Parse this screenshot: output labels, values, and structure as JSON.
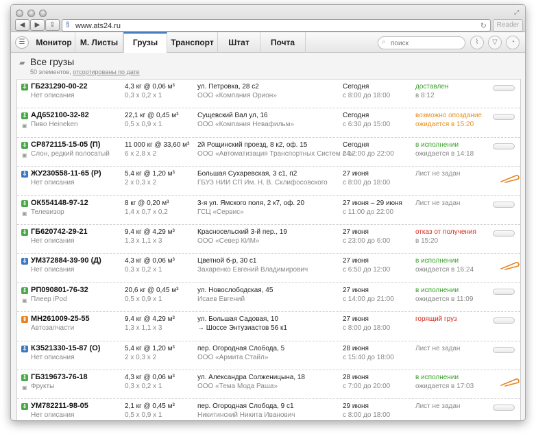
{
  "browser": {
    "url": "www.ats24.ru",
    "reader_label": "Reader"
  },
  "tabs": [
    {
      "label": "Монитор",
      "active": false
    },
    {
      "label": "М. Листы",
      "active": false
    },
    {
      "label": "Грузы",
      "active": true
    },
    {
      "label": "Транспорт",
      "active": false
    },
    {
      "label": "Штат",
      "active": false
    },
    {
      "label": "Почта",
      "active": false
    }
  ],
  "search": {
    "placeholder": "поиск"
  },
  "header": {
    "title": "Все грузы",
    "count": "50 элементов,",
    "sort_link": "отсортированы по дате"
  },
  "colors": {
    "green": "#4aa84a",
    "blue": "#3a78c4",
    "orange": "#e8831e",
    "status_green": "#3aa12a",
    "status_orange": "#e8901a",
    "status_red": "#d42b1e",
    "status_gray": "#8a8a8a",
    "clip": "#e8831e"
  },
  "rows": [
    {
      "icon": "green",
      "id": "ГБ231290-00-22",
      "desc": "Нет описания",
      "w1": "4,3 кг @ 0,06 м³",
      "w2": "0,3 x 0,2 x 1",
      "a1": "ул. Петровка, 28 с2",
      "a2": "ООО «Компания Орион»",
      "d1": "Сегодня",
      "d2": "с 8:00 до 18:00",
      "s1": "доставлен",
      "s1color": "status_green",
      "s2": "в 8:12",
      "attach": "toggle"
    },
    {
      "icon": "green",
      "id": "АД652100-32-82",
      "desc": "Пиво Heineken",
      "camera": true,
      "w1": "22,1 кг @ 0,45 м³",
      "w2": "0,5 x 0,9 x 1",
      "a1": "Сущевский Вал ул, 16",
      "a2": "ООО «Компания Невафильм»",
      "d1": "Сегодня",
      "d2": "с 6:30 до 15:00",
      "s1": "возможно опоздание",
      "s1color": "status_orange",
      "s2": "ожидается в 15:20",
      "s2color": "status_orange",
      "attach": "toggle"
    },
    {
      "icon": "green",
      "id": "СР872115-15-05 (П)",
      "desc": "Слон, редкий полосатый",
      "camera": true,
      "w1": "11 000 кг @ 33,60 м³",
      "w2": "6 x 2,8 x 2",
      "a1": "2й Рощинский проезд, 8 к2, оф. 15",
      "a2": "ООО «Автоматизация Транспортных Систем 24»",
      "d1": "Сегодня",
      "d2": "с 12:00 до 22:00",
      "s1": "в исполнении",
      "s1color": "status_green",
      "s2": "ожидается в 14:18",
      "attach": "toggle"
    },
    {
      "icon": "blue",
      "id": "ЖУ230558-11-65 (Р)",
      "desc": "Нет описания",
      "w1": "5,4 кг @ 1,20 м³",
      "w2": "2 x 0,3 x 2",
      "a1": "Большая Сухаревская, 3 с1, п2",
      "a2": "ГБУЗ НИИ СП Им. Н. В. Склифосовского",
      "d1": "27 июня",
      "d2": "с 8:00 до 18:00",
      "s1": "Лист не задан",
      "s1color": "status_gray",
      "s2": "",
      "attach": "clip"
    },
    {
      "icon": "green",
      "id": "ОК554148-97-12",
      "desc": "Телевизор",
      "camera": true,
      "w1": "8 кг @ 0,20 м³",
      "w2": "1,4 x 0,7 x 0,2",
      "a1": "3-я ул. Ямского поля, 2 к7, оф. 20",
      "a2": "ГСЦ «Сервис»",
      "d1": "27 июня – 29 июня",
      "d2": "с 11:00 до 22:00",
      "s1": "Лист не задан",
      "s1color": "status_gray",
      "s2": "",
      "attach": "toggle"
    },
    {
      "icon": "green",
      "id": "ГБ620742-29-21",
      "desc": "Нет описания",
      "w1": "9,4 кг @ 4,29 м³",
      "w2": "1,3 x 1,1 x 3",
      "a1": "Красносельский 3-й пер., 19",
      "a2": "ООО «Север КИМ»",
      "d1": "27 июня",
      "d2": "с 23:00 до 6:00",
      "s1": "отказ от получения",
      "s1color": "status_red",
      "s2": "в 15:20",
      "attach": "toggle"
    },
    {
      "icon": "blue",
      "id": "УМ372884-39-90 (Д)",
      "desc": "Нет описания",
      "w1": "4,3 кг @ 0,06 м³",
      "w2": "0,3 x 0,2 x 1",
      "a1": "Цветной б-р, 30 с1",
      "a2": "Захаренко Евгений Владимирович",
      "d1": "27 июня",
      "d2": "с 6:50 до 12:00",
      "s1": "в исполнении",
      "s1color": "status_green",
      "s2": "ожидается в 16:24",
      "attach": "clip"
    },
    {
      "icon": "green",
      "id": "РП090801-76-32",
      "desc": "Плеер iPod",
      "camera": true,
      "w1": "20,6 кг @ 0,45 м³",
      "w2": "0,5 x 0,9 x 1",
      "a1": "ул. Новослободская, 45",
      "a2": "Исаев Евгений",
      "d1": "27 июня",
      "d2": "с 14:00 до 21:00",
      "s1": "в исполнении",
      "s1color": "status_green",
      "s2": "ожидается в 11:09",
      "attach": "toggle"
    },
    {
      "icon": "orange",
      "id": "МН261009-25-55",
      "desc": "Автозапчасти",
      "w1": "9,4 кг @ 4,29 м³",
      "w2": "1,3 x 1,1 x 3",
      "a1": "ул. Большая Садовая, 10",
      "a2": "→ Шоссе Энтузиастов 56 к1",
      "a2dark": true,
      "d1": "27 июня",
      "d2": "с 8:00 до 18:00",
      "s1": "горящий груз",
      "s1color": "status_red",
      "s2": "",
      "attach": "toggle"
    },
    {
      "icon": "blue",
      "id": "КЗ521330-15-87 (О)",
      "desc": "Нет описания",
      "w1": "5,4 кг @ 1,20 м³",
      "w2": "2 x 0,3 x 2",
      "a1": "пер. Огородная Слобода, 5",
      "a2": "ООО «Армита Стайл»",
      "d1": "28 июня",
      "d2": "с 15:40 до 18:00",
      "s1": "Лист не задан",
      "s1color": "status_gray",
      "s2": "",
      "attach": "toggle"
    },
    {
      "icon": "green",
      "id": "ГБ319673-76-18",
      "desc": "Фрукты",
      "camera": true,
      "w1": "4,3 кг @ 0,06 м³",
      "w2": "0,3 x 0,2 x 1",
      "a1": "ул. Александра Солженицына, 18",
      "a2": "ООО «Тема Мода Раша»",
      "d1": "28 июня",
      "d2": "с 7:00 до 20:00",
      "s1": "в исполнении",
      "s1color": "status_green",
      "s2": "ожидается в 17:03",
      "attach": "clip"
    },
    {
      "icon": "green",
      "id": "УМ782211-98-05",
      "desc": "Нет описания",
      "w1": "2,1 кг @ 0,45 м³",
      "w2": "0,5 x 0,9 x 1",
      "a1": "пер. Огородная Слобода, 9 с1",
      "a2": "Никитинский Никита Иванович",
      "d1": "29 июня",
      "d2": "с 8:00 до 18:00",
      "s1": "Лист не задан",
      "s1color": "status_gray",
      "s2": "",
      "attach": "toggle"
    }
  ]
}
